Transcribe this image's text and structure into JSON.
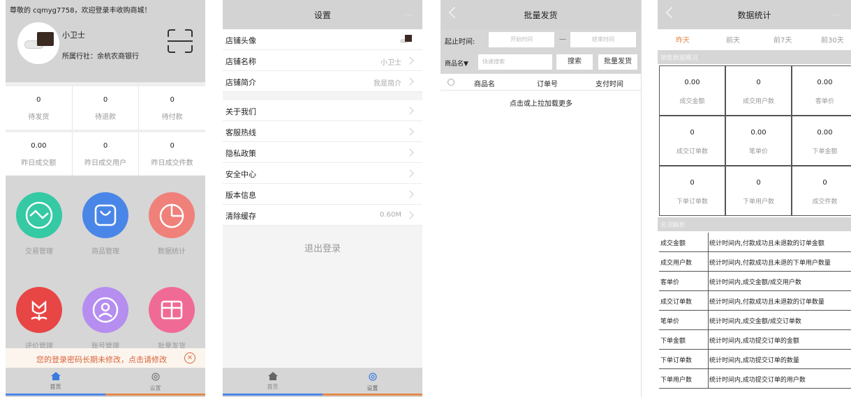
{
  "screen1": {
    "welcome": "尊敬的 cqmyg7758，欢迎登录丰收购商城！",
    "name": "小卫士",
    "bank": "所属行社：余杭农商银行",
    "stats_row1": [
      {
        "value": "0",
        "label": "待发货"
      },
      {
        "value": "0",
        "label": "待退款"
      },
      {
        "value": "0",
        "label": "待付款"
      }
    ],
    "stats_row2": [
      {
        "value": "0.00",
        "label": "昨日成交额"
      },
      {
        "value": "0",
        "label": "昨日成交用户"
      },
      {
        "value": "0",
        "label": "昨日成交件数"
      }
    ],
    "apps": [
      {
        "label": "交易管理",
        "color": "#35c9a4",
        "icon": "wave-icon"
      },
      {
        "label": "商品管理",
        "color": "#4a86e8",
        "icon": "bag-icon"
      },
      {
        "label": "数据统计",
        "color": "#f0807a",
        "icon": "pie-chart-icon"
      },
      {
        "label": "评价管理",
        "color": "#e84545",
        "icon": "flower-icon"
      },
      {
        "label": "账号管理",
        "color": "#b58ef0",
        "icon": "user-icon"
      },
      {
        "label": "批量发货",
        "color": "#f06a96",
        "icon": "box-icon"
      }
    ],
    "warning": "您的登录密码长期未修改，点击请修改",
    "tabs": [
      "首页",
      "设置"
    ]
  },
  "screen2": {
    "title": "设置",
    "rows_group1": [
      {
        "label": "店铺头像",
        "value": ""
      },
      {
        "label": "店铺名称",
        "value": "小卫士"
      },
      {
        "label": "店铺简介",
        "value": "我是简介"
      }
    ],
    "rows_group2": [
      {
        "label": "关于我们",
        "value": ""
      },
      {
        "label": "客服热线",
        "value": ""
      },
      {
        "label": "隐私政策",
        "value": ""
      },
      {
        "label": "安全中心",
        "value": ""
      },
      {
        "label": "版本信息",
        "value": ""
      },
      {
        "label": "清除缓存",
        "value": "0.60M"
      }
    ],
    "logout": "退出登录",
    "tabs": [
      "首页",
      "设置"
    ]
  },
  "screen3": {
    "title": "批量发货",
    "time_label": "起止时间:",
    "start_placeholder": "开始时间",
    "dash": "—",
    "end_placeholder": "结束时间",
    "filter_label": "商品名▼",
    "search_placeholder": "快速搜索",
    "search_btn": "搜索",
    "batch_btn": "批量发货",
    "columns": [
      "商品名",
      "订单号",
      "支付时间"
    ],
    "load_more": "点击或上拉加载更多"
  },
  "screen4": {
    "title": "数据统计",
    "tabs": [
      "昨天",
      "前天",
      "前7天",
      "前30天"
    ],
    "section1": "销售数据概况",
    "cells": [
      {
        "value": "0.00",
        "label": "成交金额"
      },
      {
        "value": "0",
        "label": "成交用户数"
      },
      {
        "value": "0.00",
        "label": "客单价"
      },
      {
        "value": "0",
        "label": "成交订单数"
      },
      {
        "value": "0.00",
        "label": "笔单价"
      },
      {
        "value": "0.00",
        "label": "下单金额"
      },
      {
        "value": "0",
        "label": "下单订单数"
      },
      {
        "value": "0",
        "label": "下单用户数"
      },
      {
        "value": "0",
        "label": "成交件数"
      }
    ],
    "section2": "名词解析",
    "definitions": [
      {
        "term": "成交金额",
        "desc": "统计时间内,付款成功且未退款的订单金额"
      },
      {
        "term": "成交用户数",
        "desc": "统计时间内,付款成功且未退的下单用户数量"
      },
      {
        "term": "客单价",
        "desc": "统计时间内,成交金额/成交用户数"
      },
      {
        "term": "成交订单数",
        "desc": "统计时间内,付款成功且未退款的订单数量"
      },
      {
        "term": "笔单价",
        "desc": "统计时间内,成交金额/成交订单数"
      },
      {
        "term": "下单金额",
        "desc": "统计时间内,成功提交订单的金额"
      },
      {
        "term": "下单订单数",
        "desc": "统计时间内,成功提交订单的数量"
      },
      {
        "term": "下单用户数",
        "desc": "统计时间内,成功提交订单的用户数"
      }
    ]
  }
}
